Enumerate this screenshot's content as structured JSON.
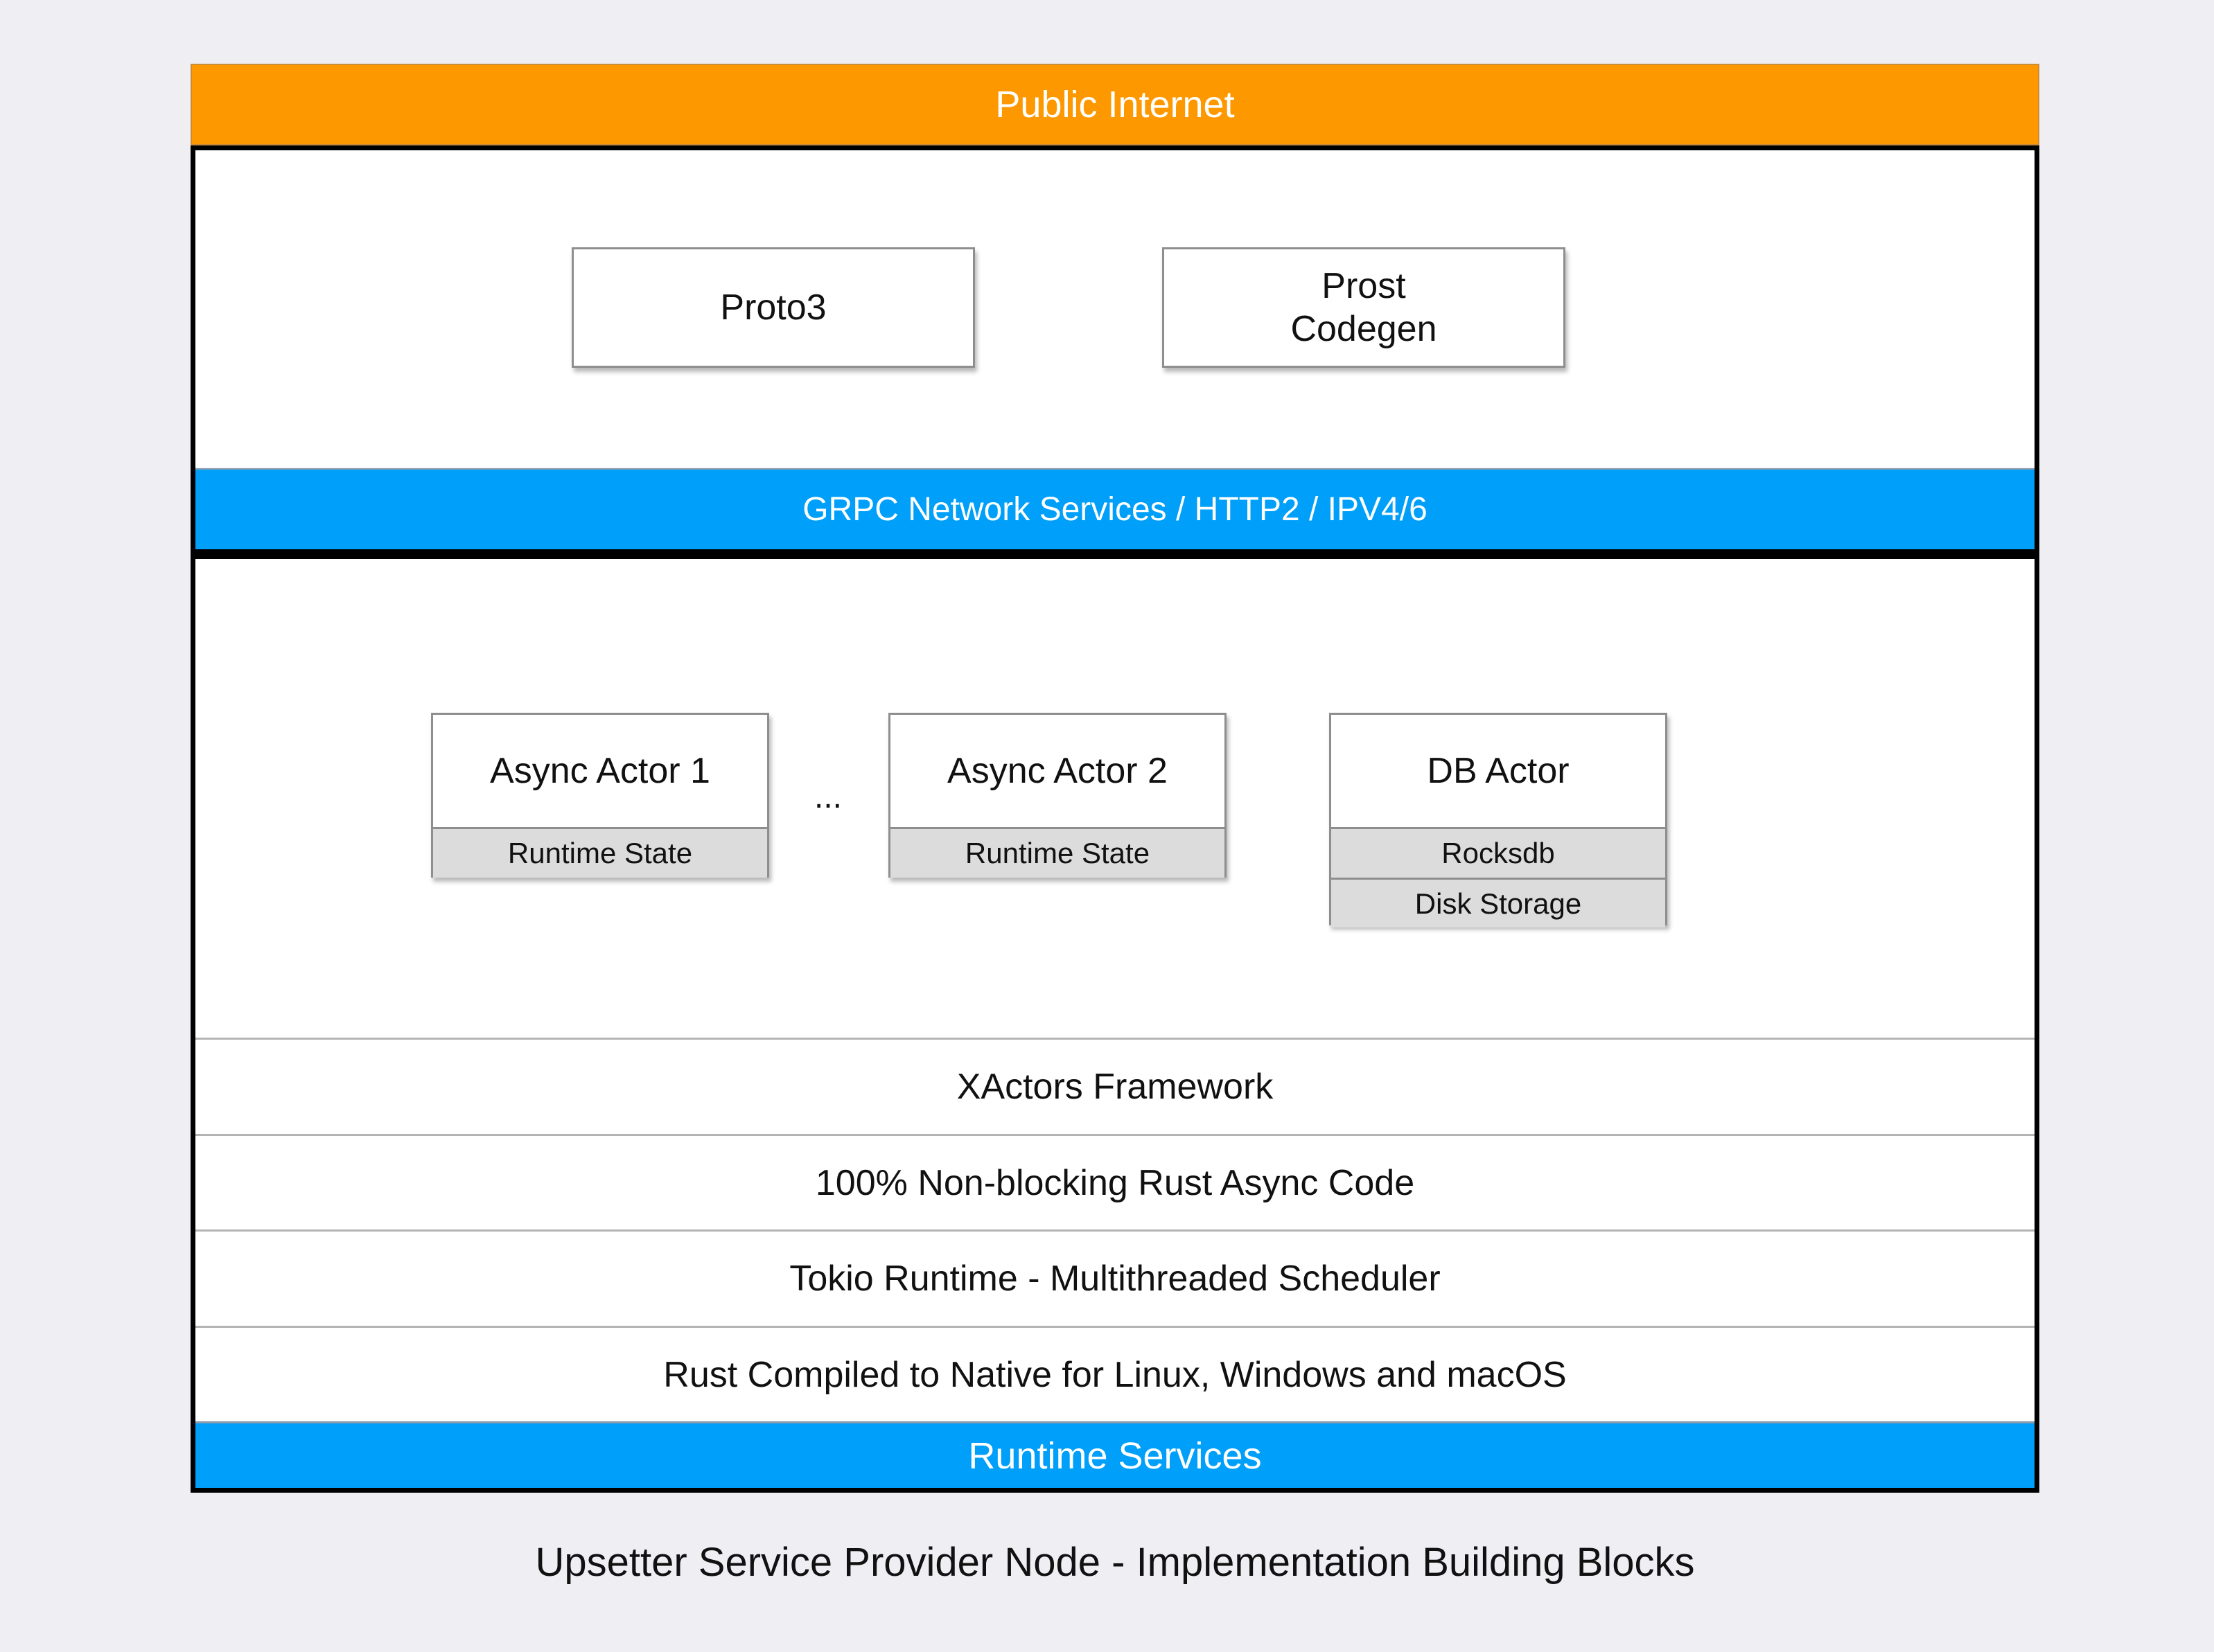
{
  "top_band": {
    "label": "Public Internet",
    "color": "#fe9800"
  },
  "network_section": {
    "cards": [
      {
        "label": "Proto3"
      },
      {
        "label_line1": "Prost",
        "label_line2": "Codegen"
      }
    ],
    "band": {
      "label": "GRPC Network Services / HTTP2 / IPV4/6",
      "color": "#009ff9"
    }
  },
  "runtime_section": {
    "actors": [
      {
        "title": "Async Actor 1",
        "sub": [
          "Runtime State"
        ]
      },
      {
        "title": "Async Actor 2",
        "sub": [
          "Runtime State"
        ]
      },
      {
        "title": "DB Actor",
        "sub": [
          "Rocksdb",
          "Disk Storage"
        ]
      }
    ],
    "ellipsis": "...",
    "layers": [
      "XActors Framework",
      "100% Non-blocking Rust Async Code",
      "Tokio Runtime - Multithreaded Scheduler",
      "Rust Compiled to Native for Linux, Windows and macOS"
    ],
    "band": {
      "label": "Runtime Services",
      "color": "#009ff9"
    }
  },
  "caption": "Upsetter Service Provider Node - Implementation Building Blocks"
}
